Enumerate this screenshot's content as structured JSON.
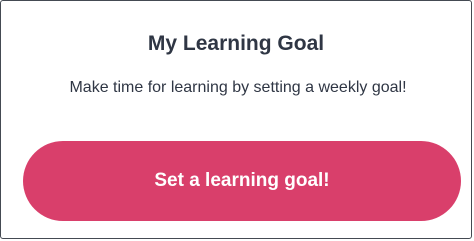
{
  "card": {
    "title": "My Learning Goal",
    "description": "Make time for learning by setting a weekly goal!",
    "button_label": "Set a learning goal!"
  },
  "colors": {
    "accent": "#d93f6b",
    "text": "#2f3644",
    "border": "#444a52"
  }
}
